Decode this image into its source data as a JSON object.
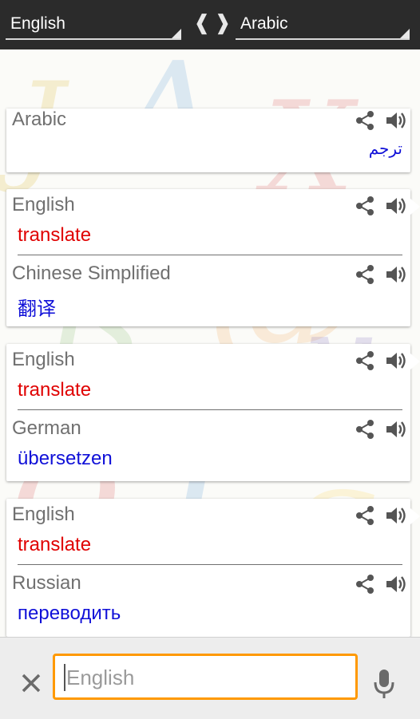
{
  "topbar": {
    "source_language": "English",
    "target_language": "Arabic",
    "left_arrow": "❰",
    "right_arrow": "❱"
  },
  "cards": [
    {
      "rows": [
        {
          "language": "Arabic",
          "text": "ترجم",
          "text_color": "blue"
        }
      ]
    },
    {
      "rows": [
        {
          "language": "English",
          "text": "translate",
          "text_color": "red"
        },
        {
          "language": "Chinese Simplified",
          "text": "翻译",
          "text_color": "blue"
        }
      ]
    },
    {
      "rows": [
        {
          "language": "English",
          "text": "translate",
          "text_color": "red"
        },
        {
          "language": "German",
          "text": "übersetzen",
          "text_color": "blue"
        }
      ]
    },
    {
      "rows": [
        {
          "language": "English",
          "text": "translate",
          "text_color": "red"
        },
        {
          "language": "Russian",
          "text": "переводить",
          "text_color": "blue"
        }
      ]
    }
  ],
  "icons": {
    "share": "share-icon",
    "speaker": "speaker-icon",
    "clear": "close-icon",
    "mic": "microphone-icon"
  },
  "bottombar": {
    "input_placeholder": "English",
    "input_value": ""
  },
  "colors": {
    "topbar_bg": "#2b2b2b",
    "source_text": "#e00000",
    "translation_text": "#1010d8",
    "input_border": "#ff9900"
  }
}
